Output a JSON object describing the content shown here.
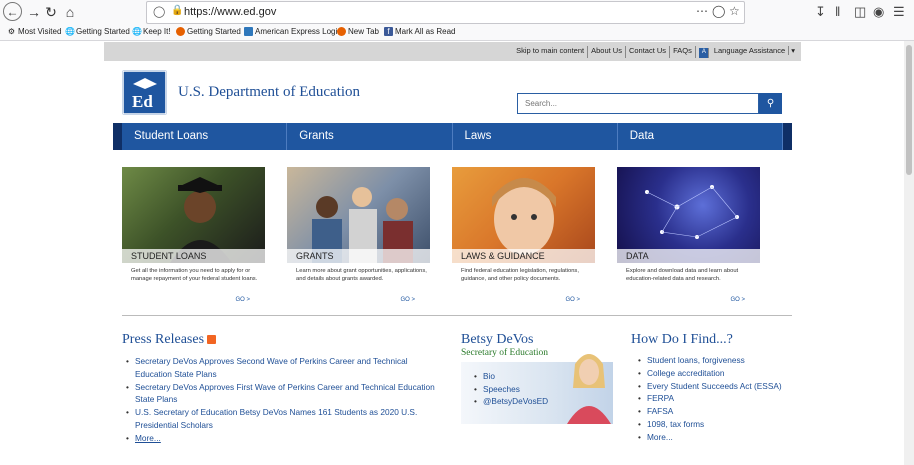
{
  "browser": {
    "url": "https://www.ed.gov",
    "bookmarks": [
      "Most Visited",
      "Getting Started",
      "Keep It!",
      "Getting Started",
      "American Express Login",
      "New Tab",
      "Mark All as Read"
    ]
  },
  "utility_nav": {
    "links": [
      "Skip to main content",
      "About Us",
      "Contact Us",
      "FAQs"
    ],
    "language": "Language Assistance"
  },
  "header": {
    "title": "U.S. Department of Education",
    "search_placeholder": "Search..."
  },
  "main_nav": [
    "Student Loans",
    "Grants",
    "Laws",
    "Data"
  ],
  "cards": [
    {
      "title": "STUDENT LOANS",
      "desc": "Get all the information you need to apply for or manage repayment of your federal student loans.",
      "go": "GO >"
    },
    {
      "title": "GRANTS",
      "desc": "Learn more about grant opportunities, applications, and details about grants awarded.",
      "go": "GO >"
    },
    {
      "title": "LAWS & GUIDANCE",
      "desc": "Find federal education legislation, regulations, guidance, and other policy documents.",
      "go": "GO >"
    },
    {
      "title": "DATA",
      "desc": "Explore and download data and learn about education-related data and research.",
      "go": "GO >"
    }
  ],
  "press": {
    "title": "Press Releases",
    "items": [
      "Secretary DeVos Approves Second Wave of Perkins Career and Technical Education State Plans",
      "Secretary DeVos Approves First Wave of Perkins Career and Technical Education State Plans",
      "U.S. Secretary of Education Betsy DeVos Names 161 Students as 2020 U.S. Presidential Scholars"
    ],
    "more": "More..."
  },
  "secretary": {
    "name": "Betsy DeVos",
    "title": "Secretary of Education",
    "links": [
      "Bio",
      "Speeches",
      "@BetsyDeVosED"
    ]
  },
  "find": {
    "title": "How Do I Find...?",
    "items": [
      "Student loans, forgiveness",
      "College accreditation",
      "Every Student Succeeds Act (ESSA)",
      "FERPA",
      "FAFSA",
      "1098, tax forms",
      "More..."
    ]
  },
  "colors": {
    "brand_blue": "#1f56a0",
    "nav_dark": "#0f2f66",
    "title_green": "#2a7a2a",
    "rss_orange": "#f26522"
  }
}
